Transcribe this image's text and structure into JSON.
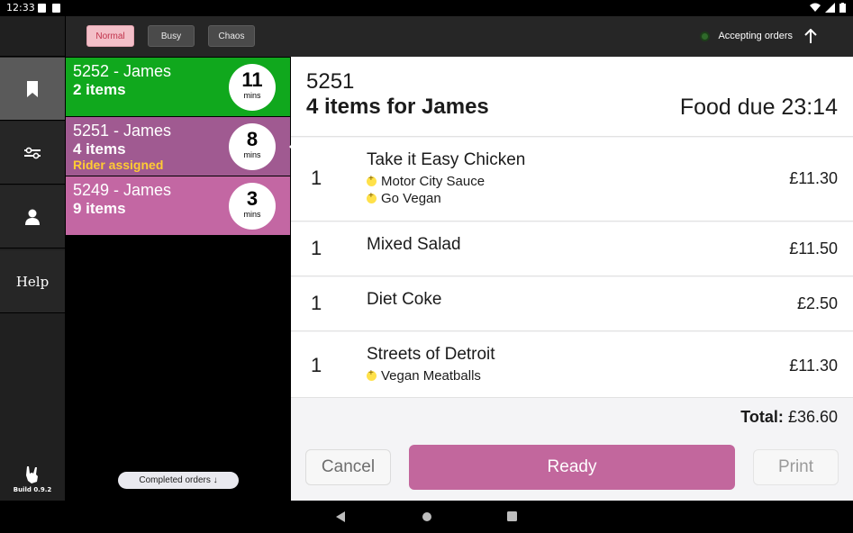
{
  "statusbar": {
    "time": "12:33"
  },
  "rail": {
    "items": [
      {
        "icon": "bookmark-icon"
      },
      {
        "icon": "sliders-icon"
      },
      {
        "icon": "person-icon"
      },
      {
        "label": "Help"
      }
    ],
    "build": "Build 0.9.2"
  },
  "toolbar": {
    "modes": [
      "Normal",
      "Busy",
      "Chaos"
    ],
    "status": "Accepting orders",
    "status_color": "#2f6a2a"
  },
  "orders": [
    {
      "title": "5252 - James",
      "items": "2 items",
      "mins": "11",
      "unit": "mins",
      "color": "#10a81d"
    },
    {
      "title": "5251 - James",
      "items": "4 items",
      "rider": "Rider assigned",
      "mins": "8",
      "unit": "mins",
      "color": "#a05a91"
    },
    {
      "title": "5249 - James",
      "items": "9 items",
      "mins": "3",
      "unit": "mins",
      "color": "#c367a3"
    }
  ],
  "completed_label": "Completed orders ↓",
  "detail": {
    "order_no": "5251",
    "items_for": "4 items for James",
    "food_due": "Food due 23:14",
    "lines": [
      {
        "qty": "1",
        "name": "Take it Easy Chicken",
        "price": "£11.30",
        "mods": [
          "Motor City Sauce",
          "Go Vegan"
        ]
      },
      {
        "qty": "1",
        "name": "Mixed Salad",
        "price": "£11.50",
        "mods": []
      },
      {
        "qty": "1",
        "name": "Diet Coke",
        "price": "£2.50",
        "mods": []
      },
      {
        "qty": "1",
        "name": "Streets of Detroit",
        "price": "£11.30",
        "mods": [
          "Vegan Meatballs"
        ]
      }
    ],
    "total_label": "Total:",
    "total_value": "£36.60",
    "buttons": {
      "cancel": "Cancel",
      "ready": "Ready",
      "print": "Print"
    }
  }
}
